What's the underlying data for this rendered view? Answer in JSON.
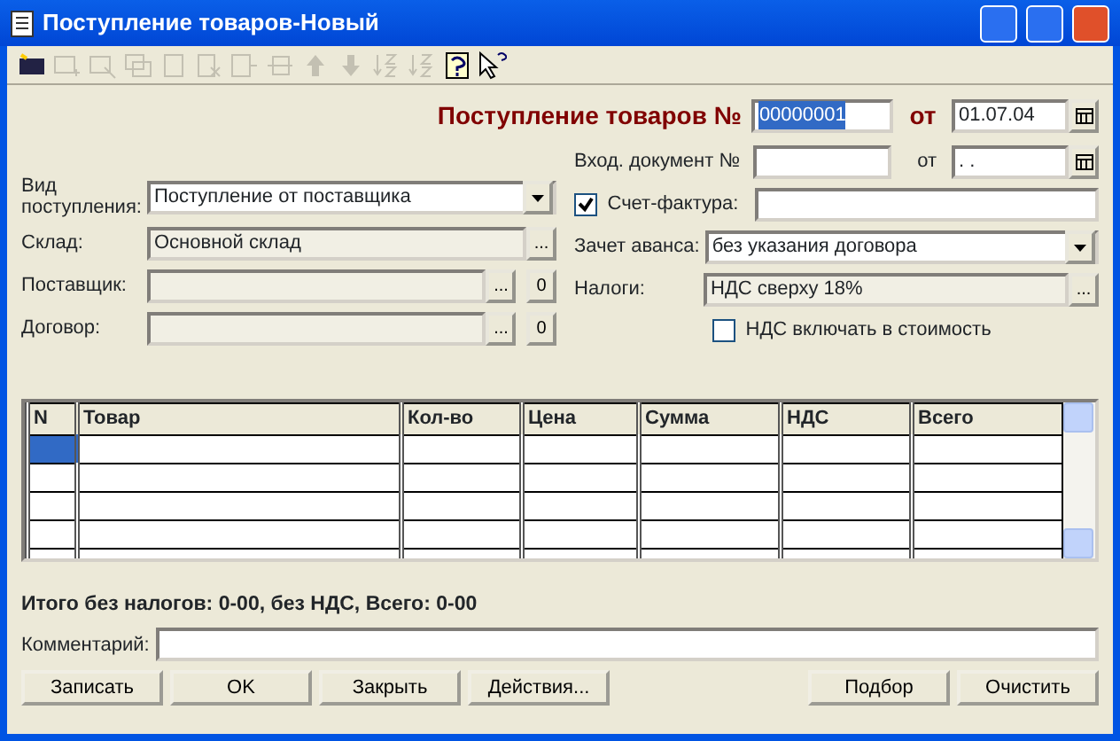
{
  "window": {
    "title": "Поступление товаров-Новый"
  },
  "toolbar": [
    {
      "kind": "new",
      "disabled": false
    },
    {
      "kind": "add",
      "disabled": true
    },
    {
      "kind": "edit",
      "disabled": true
    },
    {
      "kind": "copy",
      "disabled": true
    },
    {
      "kind": "doc",
      "disabled": true
    },
    {
      "kind": "delete",
      "disabled": true
    },
    {
      "kind": "insert",
      "disabled": true
    },
    {
      "kind": "remove",
      "disabled": true
    },
    {
      "kind": "up",
      "disabled": true
    },
    {
      "kind": "down",
      "disabled": true
    },
    {
      "kind": "sortaz",
      "disabled": true
    },
    {
      "kind": "sortza",
      "disabled": true
    },
    {
      "kind": "help",
      "disabled": false
    },
    {
      "kind": "whatsthis",
      "disabled": false
    }
  ],
  "header": {
    "title": "Поступление товаров №",
    "number": "00000001",
    "number_highlighted": true,
    "date_label": "от",
    "date": "01.07.04"
  },
  "left_fields": [
    {
      "kind": "dropdown",
      "label": "Вид поступления:",
      "value": "Поступление от поставщика"
    },
    {
      "kind": "picker",
      "label": "Склад:",
      "value": "Основной склад",
      "button": "..."
    },
    {
      "kind": "clearable",
      "label": "Поставщик:",
      "button": "...",
      "clear": "0"
    },
    {
      "kind": "clearable",
      "label": "Договор:",
      "button": "...",
      "clear": "0"
    }
  ],
  "incoming_document": {
    "label": "Вход. документ №",
    "date_label": "от",
    "date": ". ."
  },
  "invoice": {
    "label": "Счет-фактура:",
    "checked": true
  },
  "right_fields": [
    {
      "kind": "dropdown",
      "label": "Зачет аванса:",
      "value": "без указания договора"
    },
    {
      "kind": "picker",
      "label": "Налоги:",
      "value": "НДС сверху 18%",
      "button": "..."
    }
  ],
  "vat_included": {
    "label": "НДС включать в стоимость",
    "checked": false
  },
  "table": {
    "columns": [
      "N",
      "Товар",
      "Кол-во",
      "Цена",
      "Сумма",
      "НДС",
      "Всего"
    ],
    "rows": [
      {
        "selected": true
      },
      {
        "selected": false
      },
      {
        "selected": false
      },
      {
        "selected": false
      },
      {
        "selected": false
      }
    ]
  },
  "total": "Итого без налогов: 0-00, без НДС, Всего: 0-00",
  "comment": {
    "label": "Комментарий:"
  },
  "buttons_left": [
    "Записать",
    "OK",
    "Закрыть",
    "Действия..."
  ],
  "buttons_right": [
    "Подбор",
    "Очистить"
  ]
}
